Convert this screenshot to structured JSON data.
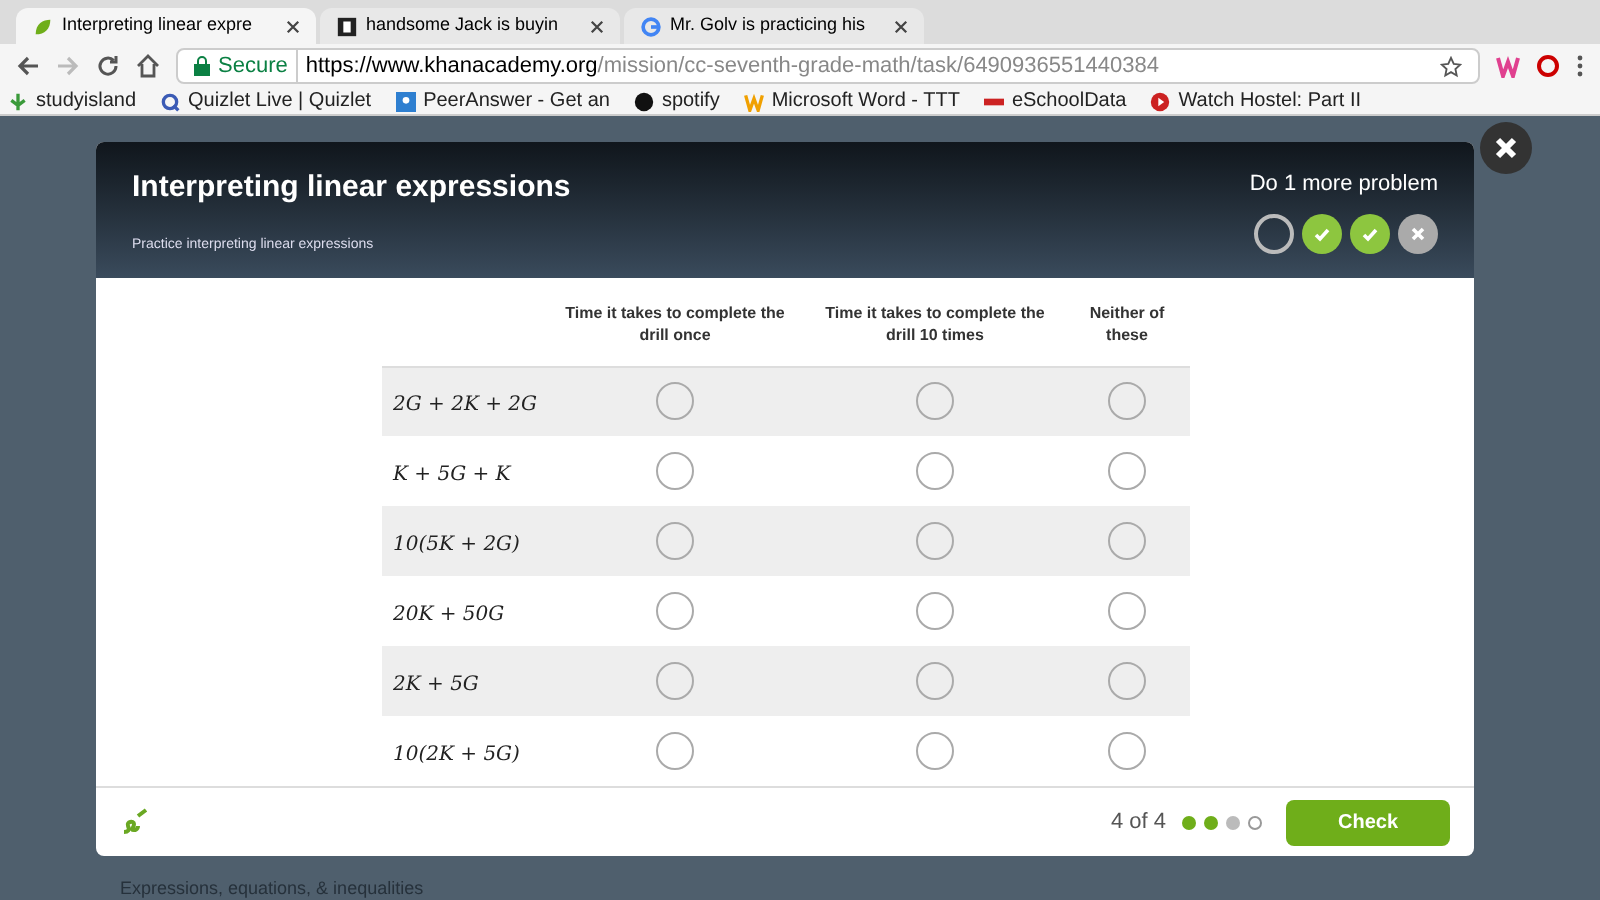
{
  "browser": {
    "tabs": [
      {
        "title": "Interpreting linear expre",
        "selected": true
      },
      {
        "title": "handsome Jack is buyin",
        "selected": false
      },
      {
        "title": "Mr. Golv is practicing his",
        "selected": false
      }
    ],
    "secure_label": "Secure",
    "url_host": "https://www.khanacademy.org",
    "url_path": "/mission/cc-seventh-grade-math/task/6490936551440384",
    "bookmarks": [
      {
        "label": "studyisland"
      },
      {
        "label": "Quizlet Live | Quizlet"
      },
      {
        "label": "PeerAnswer - Get an"
      },
      {
        "label": "spotify"
      },
      {
        "label": "Microsoft Word - TTT"
      },
      {
        "label": "eSchoolData"
      },
      {
        "label": "Watch Hostel: Part II"
      }
    ]
  },
  "exercise": {
    "title": "Interpreting linear expressions",
    "subtitle": "Practice interpreting linear expressions",
    "goal": "Do 1 more problem",
    "progress": [
      {
        "kind": "empty"
      },
      {
        "kind": "correct"
      },
      {
        "kind": "correct"
      },
      {
        "kind": "wrong"
      }
    ]
  },
  "table": {
    "columns": [
      "Time it takes to complete the drill once",
      "Time it takes to complete the drill 10 times",
      "Neither of these"
    ],
    "rows": [
      {
        "expression": "2G + 2K + 2G",
        "choices": [
          {
            "selected": false
          },
          {
            "selected": false
          },
          {
            "selected": false
          }
        ]
      },
      {
        "expression": "K + 5G + K",
        "choices": [
          {
            "selected": false
          },
          {
            "selected": false
          },
          {
            "selected": false
          }
        ]
      },
      {
        "expression": "10(5K + 2G)",
        "choices": [
          {
            "selected": false
          },
          {
            "selected": false
          },
          {
            "selected": false
          }
        ]
      },
      {
        "expression": "20K + 50G",
        "choices": [
          {
            "selected": false
          },
          {
            "selected": false
          },
          {
            "selected": false
          }
        ]
      },
      {
        "expression": "2K + 5G",
        "choices": [
          {
            "selected": false
          },
          {
            "selected": false
          },
          {
            "selected": false
          }
        ]
      },
      {
        "expression": "10(2K + 5G)",
        "choices": [
          {
            "selected": false
          },
          {
            "selected": false
          },
          {
            "selected": false
          }
        ]
      }
    ]
  },
  "footer": {
    "counter": "4 of 4",
    "dots": [
      {
        "kind": "done"
      },
      {
        "kind": "done"
      },
      {
        "kind": "seen"
      },
      {
        "kind": "todo"
      }
    ],
    "check_button": "Check"
  },
  "breadcrumb": "Expressions, equations, & inequalities"
}
